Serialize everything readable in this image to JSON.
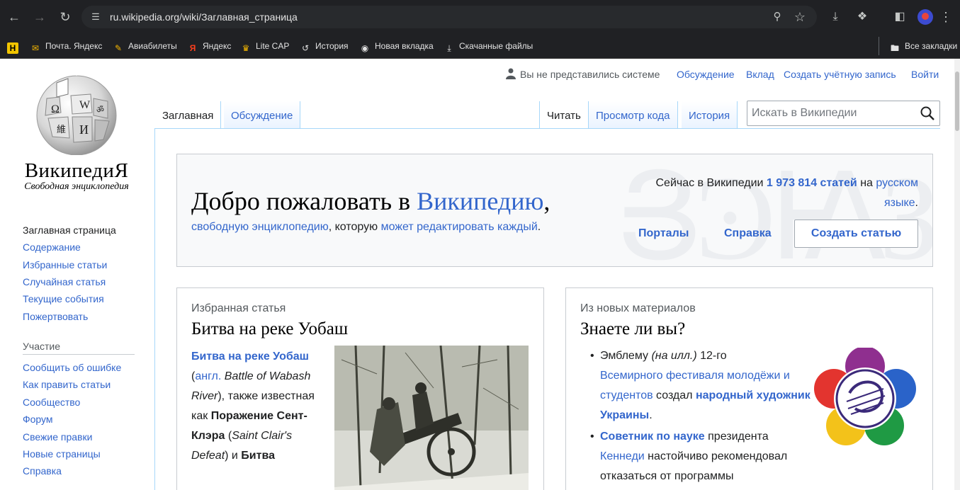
{
  "browser": {
    "url": "ru.wikipedia.org/wiki/Заглавная_страница",
    "bookmarks": [
      {
        "label": "",
        "icon": "yandex-h-icon"
      },
      {
        "label": "Почта. Яндекс",
        "icon": "mail-icon"
      },
      {
        "label": "Авиабилеты",
        "icon": "pencil-icon"
      },
      {
        "label": "Яндекс",
        "icon": "yandex-icon"
      },
      {
        "label": "Lite CAP",
        "icon": "cap-icon"
      },
      {
        "label": "История",
        "icon": "history-icon"
      },
      {
        "label": "Новая вкладка",
        "icon": "globe-icon"
      },
      {
        "label": "Скачанные файлы",
        "icon": "download-icon"
      }
    ],
    "all_bookmarks": "Все закладки"
  },
  "wiki": {
    "logo": {
      "wordmark": "ВикипедиЯ",
      "tagline": "Свободная энциклопедия"
    },
    "personal": {
      "not_logged": "Вы не представились системе",
      "talk": "Обсуждение",
      "contributions": "Вклад",
      "create_account": "Создать учётную запись",
      "login": "Войти"
    },
    "tabs_left": [
      "Заглавная",
      "Обсуждение"
    ],
    "tabs_right": [
      "Читать",
      "Просмотр кода",
      "История"
    ],
    "search": {
      "placeholder": "Искать в Википедии"
    },
    "sidebar": {
      "nav": [
        "Заглавная страница",
        "Содержание",
        "Избранные статьи",
        "Случайная статья",
        "Текущие события",
        "Пожертвовать"
      ],
      "participation_heading": "Участие",
      "participation": [
        "Сообщить об ошибке",
        "Как править статьи",
        "Сообщество",
        "Форум",
        "Свежие правки",
        "Новые страницы",
        "Справка"
      ]
    },
    "welcome": {
      "title_prefix": "Добро пожаловать в ",
      "title_link": "Википедию",
      "title_suffix": ",",
      "sub_link1": "свободную энциклопедию",
      "sub_mid": ", которую ",
      "sub_link2": "может редактировать каждый",
      "sub_end": ".",
      "stats_prefix": "Сейчас в Википедии ",
      "stats_count": "1 973 814 статей",
      "stats_mid": " на ",
      "stats_lang1": "русском",
      "stats_lang2": "языке",
      "stats_end": ".",
      "portals": "Порталы",
      "help": "Справка",
      "create": "Создать статью"
    },
    "featured": {
      "kicker": "Избранная статья",
      "title": "Битва на реке Уобаш",
      "bold_link": "Битва на реке Уобаш",
      "open_paren": "(",
      "lang_link": "англ.",
      "en_name": "Battle of Wabash River",
      "after_en": "), также известная как ",
      "alt_bold": "Поражение Сент-Клэра",
      "alt_open": " (",
      "alt_en": "Saint Clair's Defeat",
      "alt_close": ") и ",
      "tail_bold": "Битва"
    },
    "dyk": {
      "kicker": "Из новых материалов",
      "title": "Знаете ли вы?",
      "item1_a": "Эмблему ",
      "item1_b": "(на илл.)",
      "item1_c": " 12-го ",
      "item1_link": "Всемирного фестиваля молодёжи и студентов",
      "item1_d": " создал ",
      "item1_link2": "народный художник Украины",
      "item1_e": ".",
      "item2_link": "Советник по науке",
      "item2_a": " президента ",
      "item2_link2": "Кеннеди",
      "item2_b": " настойчиво рекомендовал отказаться от программы"
    }
  }
}
